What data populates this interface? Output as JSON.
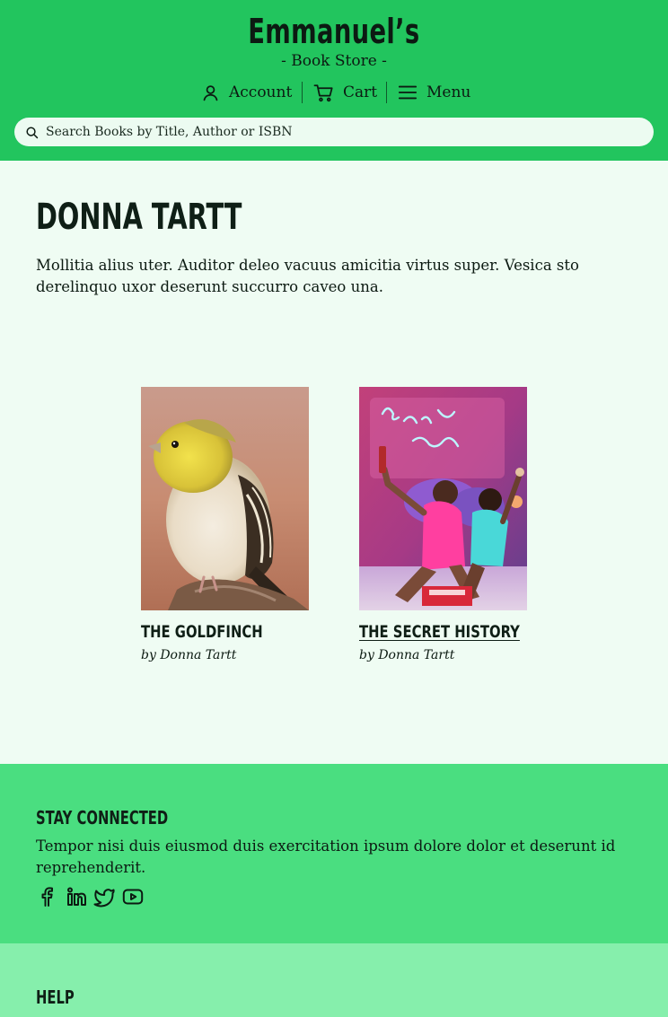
{
  "header": {
    "brand_name": "Emmanuel’s",
    "brand_subtitle": "- Book Store -",
    "nav": {
      "account_label": "Account",
      "cart_label": "Cart",
      "menu_label": "Menu"
    },
    "search": {
      "placeholder": "Search Books by Title, Author or ISBN",
      "value": ""
    }
  },
  "author": {
    "name": "Donna Tartt",
    "bio": "Mollitia alius uter. Auditor deleo vacuus amicitia virtus super. Vesica sto derelinquo uxor deserunt succurro caveo una."
  },
  "books": [
    {
      "title": "The Goldfinch",
      "byline": "by Donna Tartt",
      "cover": "goldfinch bird photo"
    },
    {
      "title": "The Secret History",
      "byline": "by Donna Tartt",
      "cover": "neon party photo"
    }
  ],
  "footer": {
    "connect_heading": "Stay Connected",
    "connect_text": "Tempor nisi duis eiusmod duis exercitation ipsum dolore dolor et deserunt id reprehenderit.",
    "socials": [
      "facebook-icon",
      "linkedin-icon",
      "twitter-icon",
      "youtube-icon"
    ],
    "help_heading": "Help"
  },
  "colors": {
    "header_bg": "#22c55e",
    "page_bg": "#effcf3",
    "footer_connect_bg": "#4ade80",
    "footer_help_bg": "#86efac"
  }
}
